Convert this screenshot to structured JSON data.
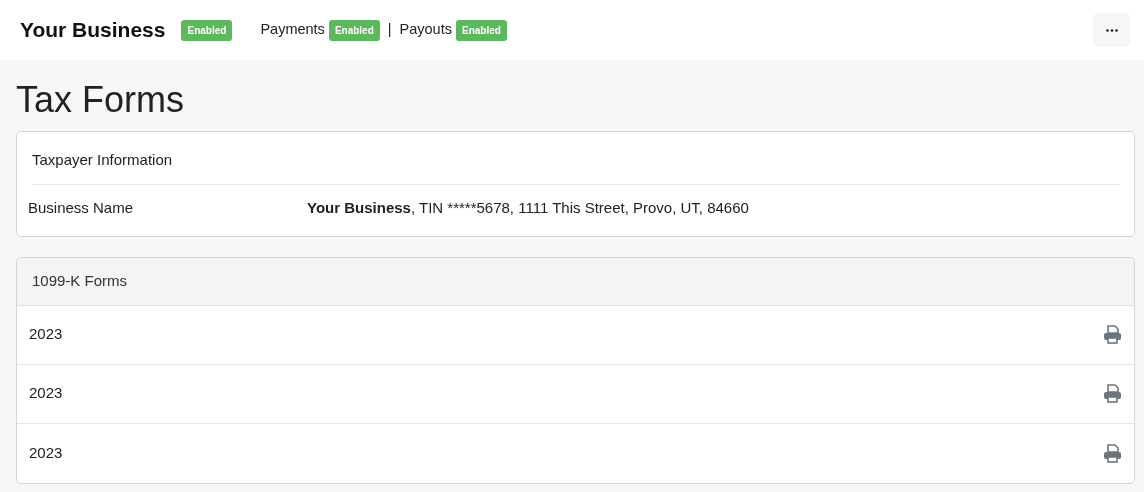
{
  "header": {
    "business": "Your Business",
    "business_status": "Enabled",
    "services": [
      {
        "label": "Payments",
        "status": "Enabled"
      },
      {
        "label": "Payouts",
        "status": "Enabled"
      }
    ],
    "separator": "|"
  },
  "page_title": "Tax Forms",
  "taxpayer_card": {
    "title": "Taxpayer Information",
    "rows": [
      {
        "label": "Business Name",
        "value_bold": "Your Business",
        "value_rest": ", TIN *****5678, 1111 This Street, Provo, UT, 84660"
      }
    ]
  },
  "forms_card": {
    "title": "1099-K Forms",
    "rows": [
      {
        "year": "2023"
      },
      {
        "year": "2023"
      },
      {
        "year": "2023"
      }
    ]
  }
}
